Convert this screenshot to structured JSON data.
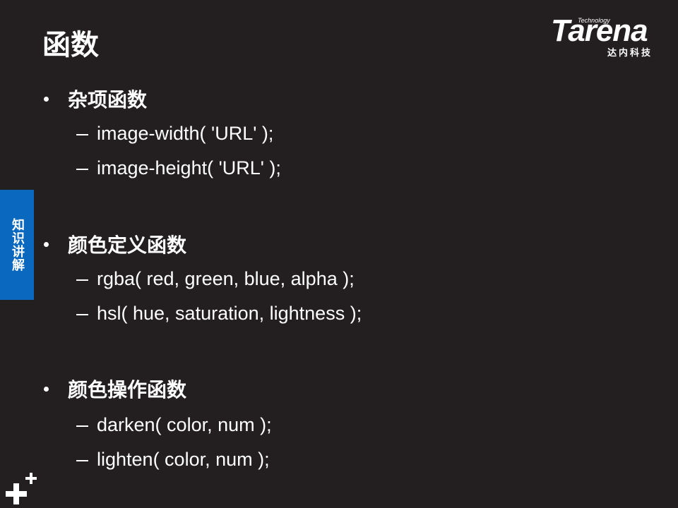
{
  "slide": {
    "title": "函数",
    "side_tab": "知识讲解"
  },
  "logo": {
    "word": "Tarena",
    "tagline": "Technology",
    "cn": "达内科技"
  },
  "sections": [
    {
      "heading": "杂项函数",
      "items": [
        "image-width( 'URL' );",
        "image-height( 'URL' );"
      ]
    },
    {
      "heading": "颜色定义函数",
      "items": [
        "rgba( red, green, blue, alpha );",
        "hsl( hue, saturation, lightness );"
      ]
    },
    {
      "heading": "颜色操作函数",
      "items": [
        "darken( color, num );",
        "lighten( color, num );"
      ]
    }
  ],
  "icons": {
    "corner": "plus-plus-icon"
  },
  "colors": {
    "background": "#231f20",
    "side_tab": "#0a68bf",
    "text": "#ffffff"
  }
}
